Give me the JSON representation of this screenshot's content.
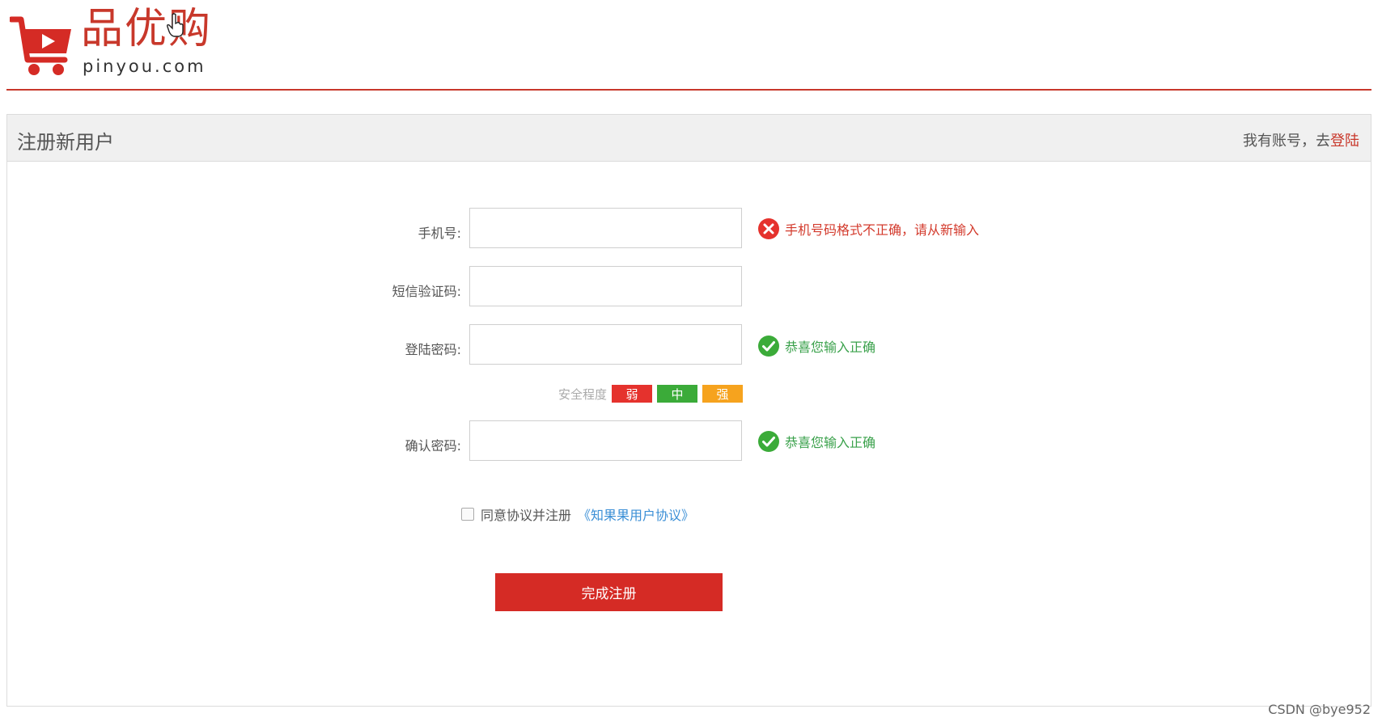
{
  "header": {
    "brand_name": "品优购",
    "brand_domain": "pinyou.com"
  },
  "panel": {
    "title": "注册新用户",
    "login_prompt": "我有账号，去",
    "login_link": "登陆"
  },
  "form": {
    "phone": {
      "label": "手机号:",
      "value": "",
      "error": "手机号码格式不正确，请从新输入"
    },
    "sms_code": {
      "label": "短信验证码:",
      "value": ""
    },
    "password": {
      "label": "登陆密码:",
      "value": "",
      "ok": "恭喜您输入正确"
    },
    "strength": {
      "label": "安全程度",
      "levels": [
        {
          "text": "弱",
          "color": "#e5322d"
        },
        {
          "text": "中",
          "color": "#3bab39"
        },
        {
          "text": "强",
          "color": "#f6a31e"
        }
      ]
    },
    "confirm_password": {
      "label": "确认密码:",
      "value": "",
      "ok": "恭喜您输入正确"
    },
    "agreement": {
      "text": "同意协议并注册",
      "link": "《知果果用户协议》",
      "checked": false
    },
    "submit_label": "完成注册"
  },
  "watermark": "CSDN @bye952",
  "colors": {
    "brand_red": "#c8382b",
    "error_red": "#d33a2c",
    "ok_green": "#3aa14b",
    "link_blue": "#3b8fd6"
  }
}
